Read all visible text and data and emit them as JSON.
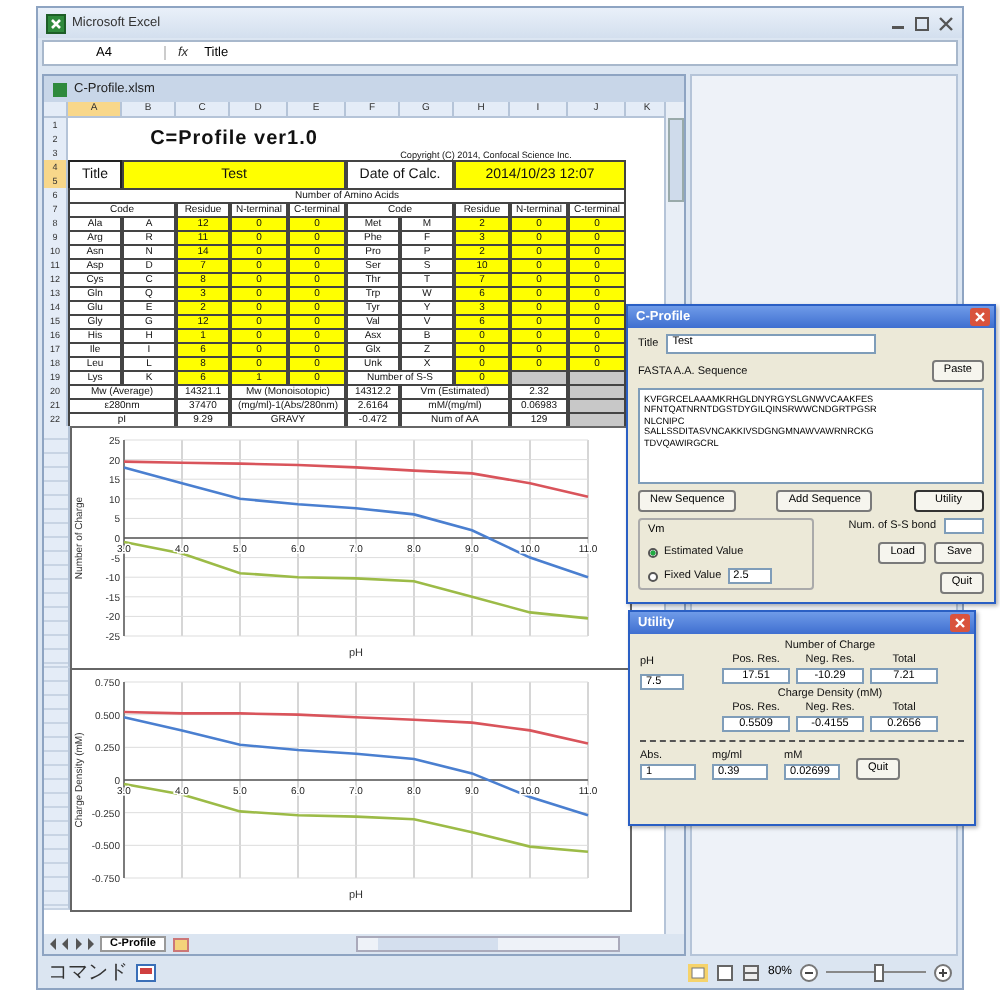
{
  "app": {
    "title": "Microsoft Excel"
  },
  "formula_bar": {
    "cell": "A4",
    "function_label": "fx",
    "value": "Title"
  },
  "workbook": {
    "title": "C-Profile.xlsm",
    "columns": [
      {
        "label": "A",
        "selected": true
      },
      {
        "label": "B",
        "selected": false
      },
      {
        "label": "C",
        "selected": false
      },
      {
        "label": "D",
        "selected": false
      },
      {
        "label": "E",
        "selected": false
      },
      {
        "label": "F",
        "selected": false
      },
      {
        "label": "G",
        "selected": false
      },
      {
        "label": "H",
        "selected": false
      },
      {
        "label": "I",
        "selected": false
      },
      {
        "label": "J",
        "selected": false
      },
      {
        "label": "K",
        "selected": false
      }
    ],
    "rows": [
      {
        "nums": [
          "1",
          "2",
          "3"
        ],
        "selected": false,
        "cells": [
          {
            "kind": "blank",
            "text": ""
          },
          {
            "kind": "title",
            "text": "C=Profile ver1.0"
          },
          {
            "kind": "merged",
            "text": ""
          },
          {
            "kind": "merged",
            "text": ""
          },
          {
            "kind": "merged",
            "text": ""
          },
          {
            "kind": "note",
            "text": "Copyright (C) 2014, Confocal Science Inc."
          },
          {
            "kind": "merged",
            "text": ""
          },
          {
            "kind": "merged",
            "text": ""
          },
          {
            "kind": "merged",
            "text": ""
          },
          {
            "kind": "merged",
            "text": ""
          }
        ]
      },
      {
        "nums": [
          "4",
          "5"
        ],
        "selected": true,
        "cells": [
          {
            "kind": "active",
            "text": "Title"
          },
          {
            "kind": "input",
            "text": "Test"
          },
          {
            "kind": "merged",
            "text": ""
          },
          {
            "kind": "merged",
            "text": ""
          },
          {
            "kind": "merged",
            "text": ""
          },
          {
            "kind": "plain",
            "text": "Date of Calc."
          },
          {
            "kind": "merged",
            "text": ""
          },
          {
            "kind": "input",
            "text": "2014/10/23 12:07"
          },
          {
            "kind": "merged",
            "text": ""
          },
          {
            "kind": "merged",
            "text": ""
          }
        ]
      },
      {
        "nums": [
          "6"
        ],
        "selected": false,
        "cells": [
          {
            "kind": "lead",
            "text": ""
          },
          {
            "kind": "lead",
            "text": ""
          },
          {
            "kind": "lead",
            "text": ""
          },
          {
            "kind": "lead",
            "text": ""
          },
          {
            "kind": "plain",
            "text": "Number of Amino Acids"
          },
          {
            "kind": "merged",
            "text": ""
          },
          {
            "kind": "merged",
            "text": ""
          },
          {
            "kind": "merged",
            "text": ""
          },
          {
            "kind": "merged",
            "text": ""
          },
          {
            "kind": "merged",
            "text": ""
          }
        ]
      },
      {
        "nums": [
          "7"
        ],
        "selected": false,
        "cells": [
          {
            "kind": "plain",
            "text": "Code"
          },
          {
            "kind": "merged",
            "text": ""
          },
          {
            "kind": "plain",
            "text": "Residue"
          },
          {
            "kind": "plain",
            "text": "N-terminal"
          },
          {
            "kind": "plain",
            "text": "C-terminal"
          },
          {
            "kind": "plain",
            "text": "Code"
          },
          {
            "kind": "merged",
            "text": ""
          },
          {
            "kind": "plain",
            "text": "Residue"
          },
          {
            "kind": "plain",
            "text": "N-terminal"
          },
          {
            "kind": "plain",
            "text": "C-terminal"
          }
        ]
      },
      {
        "nums": [
          "8"
        ],
        "selected": false,
        "cells": [
          {
            "kind": "plain",
            "text": "Ala"
          },
          {
            "kind": "plain",
            "text": "A"
          },
          {
            "kind": "input",
            "text": "12"
          },
          {
            "kind": "input",
            "text": "0"
          },
          {
            "kind": "input",
            "text": "0"
          },
          {
            "kind": "plain",
            "text": "Met"
          },
          {
            "kind": "plain",
            "text": "M"
          },
          {
            "kind": "input",
            "text": "2"
          },
          {
            "kind": "input",
            "text": "0"
          },
          {
            "kind": "input",
            "text": "0"
          }
        ]
      },
      {
        "nums": [
          "9"
        ],
        "selected": false,
        "cells": [
          {
            "kind": "plain",
            "text": "Arg"
          },
          {
            "kind": "plain",
            "text": "R"
          },
          {
            "kind": "input",
            "text": "11"
          },
          {
            "kind": "input",
            "text": "0"
          },
          {
            "kind": "input",
            "text": "0"
          },
          {
            "kind": "plain",
            "text": "Phe"
          },
          {
            "kind": "plain",
            "text": "F"
          },
          {
            "kind": "input",
            "text": "3"
          },
          {
            "kind": "input",
            "text": "0"
          },
          {
            "kind": "input",
            "text": "0"
          }
        ]
      },
      {
        "nums": [
          "10"
        ],
        "selected": false,
        "cells": [
          {
            "kind": "plain",
            "text": "Asn"
          },
          {
            "kind": "plain",
            "text": "N"
          },
          {
            "kind": "input",
            "text": "14"
          },
          {
            "kind": "input",
            "text": "0"
          },
          {
            "kind": "input",
            "text": "0"
          },
          {
            "kind": "plain",
            "text": "Pro"
          },
          {
            "kind": "plain",
            "text": "P"
          },
          {
            "kind": "input",
            "text": "2"
          },
          {
            "kind": "input",
            "text": "0"
          },
          {
            "kind": "input",
            "text": "0"
          }
        ]
      },
      {
        "nums": [
          "11"
        ],
        "selected": false,
        "cells": [
          {
            "kind": "plain",
            "text": "Asp"
          },
          {
            "kind": "plain",
            "text": "D"
          },
          {
            "kind": "input",
            "text": "7"
          },
          {
            "kind": "input",
            "text": "0"
          },
          {
            "kind": "input",
            "text": "0"
          },
          {
            "kind": "plain",
            "text": "Ser"
          },
          {
            "kind": "plain",
            "text": "S"
          },
          {
            "kind": "input",
            "text": "10"
          },
          {
            "kind": "input",
            "text": "0"
          },
          {
            "kind": "input",
            "text": "0"
          }
        ]
      },
      {
        "nums": [
          "12"
        ],
        "selected": false,
        "cells": [
          {
            "kind": "plain",
            "text": "Cys"
          },
          {
            "kind": "plain",
            "text": "C"
          },
          {
            "kind": "input",
            "text": "8"
          },
          {
            "kind": "input",
            "text": "0"
          },
          {
            "kind": "input",
            "text": "0"
          },
          {
            "kind": "plain",
            "text": "Thr"
          },
          {
            "kind": "plain",
            "text": "T"
          },
          {
            "kind": "input",
            "text": "7"
          },
          {
            "kind": "input",
            "text": "0"
          },
          {
            "kind": "input",
            "text": "0"
          }
        ]
      },
      {
        "nums": [
          "13"
        ],
        "selected": false,
        "cells": [
          {
            "kind": "plain",
            "text": "Gln"
          },
          {
            "kind": "plain",
            "text": "Q"
          },
          {
            "kind": "input",
            "text": "3"
          },
          {
            "kind": "input",
            "text": "0"
          },
          {
            "kind": "input",
            "text": "0"
          },
          {
            "kind": "plain",
            "text": "Trp"
          },
          {
            "kind": "plain",
            "text": "W"
          },
          {
            "kind": "input",
            "text": "6"
          },
          {
            "kind": "input",
            "text": "0"
          },
          {
            "kind": "input",
            "text": "0"
          }
        ]
      },
      {
        "nums": [
          "14"
        ],
        "selected": false,
        "cells": [
          {
            "kind": "plain",
            "text": "Glu"
          },
          {
            "kind": "plain",
            "text": "E"
          },
          {
            "kind": "input",
            "text": "2"
          },
          {
            "kind": "input",
            "text": "0"
          },
          {
            "kind": "input",
            "text": "0"
          },
          {
            "kind": "plain",
            "text": "Tyr"
          },
          {
            "kind": "plain",
            "text": "Y"
          },
          {
            "kind": "input",
            "text": "3"
          },
          {
            "kind": "input",
            "text": "0"
          },
          {
            "kind": "input",
            "text": "0"
          }
        ]
      },
      {
        "nums": [
          "15"
        ],
        "selected": false,
        "cells": [
          {
            "kind": "plain",
            "text": "Gly"
          },
          {
            "kind": "plain",
            "text": "G"
          },
          {
            "kind": "input",
            "text": "12"
          },
          {
            "kind": "input",
            "text": "0"
          },
          {
            "kind": "input",
            "text": "0"
          },
          {
            "kind": "plain",
            "text": "Val"
          },
          {
            "kind": "plain",
            "text": "V"
          },
          {
            "kind": "input",
            "text": "6"
          },
          {
            "kind": "input",
            "text": "0"
          },
          {
            "kind": "input",
            "text": "0"
          }
        ]
      },
      {
        "nums": [
          "16"
        ],
        "selected": false,
        "cells": [
          {
            "kind": "plain",
            "text": "His"
          },
          {
            "kind": "plain",
            "text": "H"
          },
          {
            "kind": "input",
            "text": "1"
          },
          {
            "kind": "input",
            "text": "0"
          },
          {
            "kind": "input",
            "text": "0"
          },
          {
            "kind": "plain",
            "text": "Asx"
          },
          {
            "kind": "plain",
            "text": "B"
          },
          {
            "kind": "input",
            "text": "0"
          },
          {
            "kind": "input",
            "text": "0"
          },
          {
            "kind": "input",
            "text": "0"
          }
        ]
      },
      {
        "nums": [
          "17"
        ],
        "selected": false,
        "cells": [
          {
            "kind": "plain",
            "text": "Ile"
          },
          {
            "kind": "plain",
            "text": "I"
          },
          {
            "kind": "input",
            "text": "6"
          },
          {
            "kind": "input",
            "text": "0"
          },
          {
            "kind": "input",
            "text": "0"
          },
          {
            "kind": "plain",
            "text": "Glx"
          },
          {
            "kind": "plain",
            "text": "Z"
          },
          {
            "kind": "input",
            "text": "0"
          },
          {
            "kind": "input",
            "text": "0"
          },
          {
            "kind": "input",
            "text": "0"
          }
        ]
      },
      {
        "nums": [
          "18"
        ],
        "selected": false,
        "cells": [
          {
            "kind": "plain",
            "text": "Leu"
          },
          {
            "kind": "plain",
            "text": "L"
          },
          {
            "kind": "input",
            "text": "8"
          },
          {
            "kind": "input",
            "text": "0"
          },
          {
            "kind": "input",
            "text": "0"
          },
          {
            "kind": "plain",
            "text": "Unk"
          },
          {
            "kind": "plain",
            "text": "X"
          },
          {
            "kind": "input",
            "text": "0"
          },
          {
            "kind": "input",
            "text": "0"
          },
          {
            "kind": "input",
            "text": "0"
          }
        ]
      },
      {
        "nums": [
          "19"
        ],
        "selected": false,
        "cells": [
          {
            "kind": "plain",
            "text": "Lys"
          },
          {
            "kind": "plain",
            "text": "K"
          },
          {
            "kind": "input",
            "text": "6"
          },
          {
            "kind": "input",
            "text": "1"
          },
          {
            "kind": "input",
            "text": "0"
          },
          {
            "kind": "plain",
            "text": "Number of S-S"
          },
          {
            "kind": "merged",
            "text": ""
          },
          {
            "kind": "input",
            "text": "0"
          },
          {
            "kind": "empty",
            "text": ""
          },
          {
            "kind": "empty",
            "text": ""
          }
        ]
      },
      {
        "nums": [
          "20"
        ],
        "selected": false,
        "cells": [
          {
            "kind": "plain",
            "text": "Mw (Average)"
          },
          {
            "kind": "merged",
            "text": ""
          },
          {
            "kind": "plain",
            "text": "14321.1"
          },
          {
            "kind": "plain",
            "text": "Mw (Monoisotopic)"
          },
          {
            "kind": "merged",
            "text": ""
          },
          {
            "kind": "plain",
            "text": "14312.2"
          },
          {
            "kind": "plain",
            "text": "Vm (Estimated)"
          },
          {
            "kind": "merged",
            "text": ""
          },
          {
            "kind": "plain",
            "text": "2.32"
          },
          {
            "kind": "empty",
            "text": ""
          }
        ]
      },
      {
        "nums": [
          "21"
        ],
        "selected": false,
        "cells": [
          {
            "kind": "plain",
            "text": "ε280nm"
          },
          {
            "kind": "merged",
            "text": ""
          },
          {
            "kind": "plain",
            "text": "37470"
          },
          {
            "kind": "plain",
            "text": "(mg/ml)-1(Abs/280nm)"
          },
          {
            "kind": "merged",
            "text": ""
          },
          {
            "kind": "plain",
            "text": "2.6164"
          },
          {
            "kind": "plain",
            "text": "mM/(mg/ml)"
          },
          {
            "kind": "merged",
            "text": ""
          },
          {
            "kind": "plain",
            "text": "0.06983"
          },
          {
            "kind": "empty",
            "text": ""
          }
        ]
      },
      {
        "nums": [
          "22"
        ],
        "selected": false,
        "cells": [
          {
            "kind": "plain",
            "text": "pI"
          },
          {
            "kind": "merged",
            "text": ""
          },
          {
            "kind": "plain",
            "text": "9.29"
          },
          {
            "kind": "plain",
            "text": "GRAVY"
          },
          {
            "kind": "merged",
            "text": ""
          },
          {
            "kind": "plain",
            "text": "-0.472"
          },
          {
            "kind": "plain",
            "text": "Num of AA"
          },
          {
            "kind": "merged",
            "text": ""
          },
          {
            "kind": "plain",
            "text": "129"
          },
          {
            "kind": "empty",
            "text": ""
          }
        ]
      }
    ],
    "charts": [
      {
        "chart_data": {
          "type": "line",
          "grid": true,
          "xlabel": "pH",
          "ylabel": "Number of Charge",
          "x": [
            3,
            4,
            5,
            6,
            7,
            8,
            9,
            10,
            11
          ],
          "xlim": [
            3,
            11
          ],
          "ylim": [
            -25,
            25
          ],
          "xticks": [
            {
              "value": 3,
              "label": "3.0"
            },
            {
              "value": 4,
              "label": "4.0"
            },
            {
              "value": 5,
              "label": "5.0"
            },
            {
              "value": 6,
              "label": "6.0"
            },
            {
              "value": 7,
              "label": "7.0"
            },
            {
              "value": 8,
              "label": "8.0"
            },
            {
              "value": 9,
              "label": "9.0"
            },
            {
              "value": 10,
              "label": "10.0"
            },
            {
              "value": 11,
              "label": "11.0"
            }
          ],
          "yticks": [
            -25,
            -20,
            -15,
            -10,
            -5,
            0,
            5,
            10,
            15,
            20,
            25
          ],
          "series": [
            {
              "color": "#d9545b",
              "values": [
                19.5,
                19.2,
                19,
                18.6,
                18,
                17.2,
                16.5,
                14,
                10.5
              ]
            },
            {
              "color": "#4a7fd0",
              "values": [
                18,
                14,
                10,
                8.6,
                7.6,
                6,
                2,
                -5,
                -10
              ]
            },
            {
              "color": "#9cbb47",
              "values": [
                -1,
                -4,
                -9,
                -10,
                -10.3,
                -11,
                -15,
                -19,
                -20.5
              ]
            }
          ]
        }
      },
      {
        "chart_data": {
          "type": "line",
          "grid": true,
          "xlabel": "pH",
          "ylabel": "Charge Density (mM)",
          "x": [
            3,
            4,
            5,
            6,
            7,
            8,
            9,
            10,
            11
          ],
          "xlim": [
            3,
            11
          ],
          "ylim": [
            -0.75,
            0.75
          ],
          "xticks": [
            {
              "value": 3,
              "label": "3.0"
            },
            {
              "value": 4,
              "label": "4.0"
            },
            {
              "value": 5,
              "label": "5.0"
            },
            {
              "value": 6,
              "label": "6.0"
            },
            {
              "value": 7,
              "label": "7.0"
            },
            {
              "value": 8,
              "label": "8.0"
            },
            {
              "value": 9,
              "label": "9.0"
            },
            {
              "value": 10,
              "label": "10.0"
            },
            {
              "value": 11,
              "label": "11.0"
            }
          ],
          "yticks": [
            {
              "value": -0.75,
              "label": "-0.750"
            },
            {
              "value": -0.5,
              "label": "-0.500"
            },
            {
              "value": -0.25,
              "label": "-0.250"
            },
            {
              "value": 0,
              "label": "0"
            },
            {
              "value": 0.25,
              "label": "0.250"
            },
            {
              "value": 0.5,
              "label": "0.500"
            },
            {
              "value": 0.75,
              "label": "0.750"
            }
          ],
          "series": [
            {
              "color": "#d9545b",
              "values": [
                0.52,
                0.51,
                0.51,
                0.5,
                0.48,
                0.46,
                0.44,
                0.38,
                0.28
              ]
            },
            {
              "color": "#4a7fd0",
              "values": [
                0.48,
                0.38,
                0.27,
                0.23,
                0.2,
                0.16,
                0.05,
                -0.13,
                -0.27
              ]
            },
            {
              "color": "#9cbb47",
              "values": [
                -0.03,
                -0.11,
                -0.24,
                -0.27,
                -0.28,
                -0.3,
                -0.4,
                -0.51,
                -0.55
              ]
            }
          ]
        }
      }
    ],
    "sheet_tabs": [
      {
        "label": "C-Profile",
        "selected": true
      }
    ]
  },
  "dialog": {
    "title": "C-Profile",
    "title_label": "Title",
    "title_value": "Test",
    "paste": "Paste",
    "sequence_label": "FASTA A.A. Sequence",
    "sequence": [
      "KVFGRCELAAAMKRHGLDNYRGYSLGNWVCAAKFES",
      "NFNTQATNRNTDGSTDYGILQINSRWWCNDGRTPGSR",
      "NLCNIPC",
      "SALLSSDITASVNCAKKIVSDGNGMNAWVAWRNRCKG",
      "TDVQAWIRGCRL"
    ],
    "buttons": [
      {
        "label": "New Sequence",
        "focused": false
      },
      {
        "label": "Add Sequence",
        "focused": false
      },
      {
        "label": "Utility",
        "focused": true
      }
    ],
    "vm": {
      "label": "Vm",
      "options": [
        {
          "label": "Estimated Value",
          "selected": true
        },
        {
          "label": "Fixed Value",
          "selected": false,
          "value": "2.5"
        }
      ]
    },
    "ss_label": "Num. of S-S bond",
    "load": "Load",
    "save": "Save",
    "quit": "Quit"
  },
  "utility": {
    "title": "Utility",
    "ph_label": "pH",
    "ph": "7.5",
    "groups": [
      {
        "title": "Number of Charge",
        "headers": [
          "Pos. Res.",
          "Neg. Res.",
          "Total"
        ],
        "values": [
          "17.51",
          "-10.29",
          "7.21"
        ]
      },
      {
        "title": "Charge Density (mM)",
        "headers": [
          "Pos. Res.",
          "Neg. Res.",
          "Total"
        ],
        "values": [
          "0.5509",
          "-0.4155",
          "0.2656"
        ]
      }
    ],
    "fields": [
      {
        "label": "Abs.",
        "value": "1"
      },
      {
        "label": "mg/ml",
        "value": "0.39"
      },
      {
        "label": "mM",
        "value": "0.02699"
      }
    ],
    "quit": "Quit"
  },
  "status_bar": {
    "mode": "コマンド",
    "zoom": "80%",
    "zoom_slider": {
      "level": 0.5
    }
  }
}
